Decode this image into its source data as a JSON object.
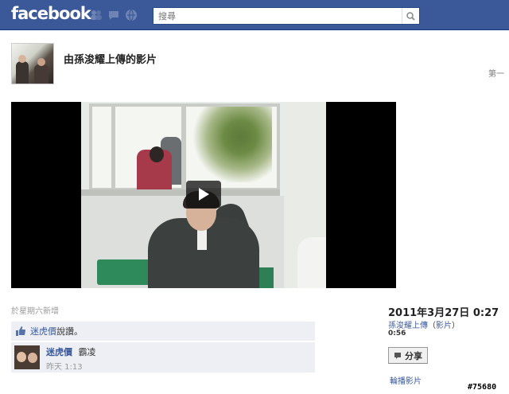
{
  "topbar": {
    "logo": "facebook",
    "search": {
      "value": "",
      "placeholder": "搜尋"
    },
    "jewels": [
      "friend-requests-icon",
      "messages-icon",
      "notifications-icon"
    ],
    "colors": {
      "bar": "#3b5998",
      "link": "#3b5998"
    }
  },
  "header": {
    "title": "由孫浚耀上傳的影片",
    "page_nav": "第一"
  },
  "video": {
    "play_icon": "play-icon"
  },
  "meta": {
    "added": "於星期六新增",
    "date": "2011年3月27日 0:27",
    "uploader": "孫浚耀上傳",
    "uploader_paren_open": "（",
    "videos_link": "影片",
    "uploader_paren_close": "）",
    "duration": "0:56",
    "share_label": "分享",
    "rotate_label": "輪播影片"
  },
  "likes": {
    "liker": "迷虎價",
    "suffix": "說讚。"
  },
  "comment": {
    "author": "迷虎價",
    "text": "霸凌",
    "time": "昨天 1:13"
  },
  "watermark": "#75680"
}
